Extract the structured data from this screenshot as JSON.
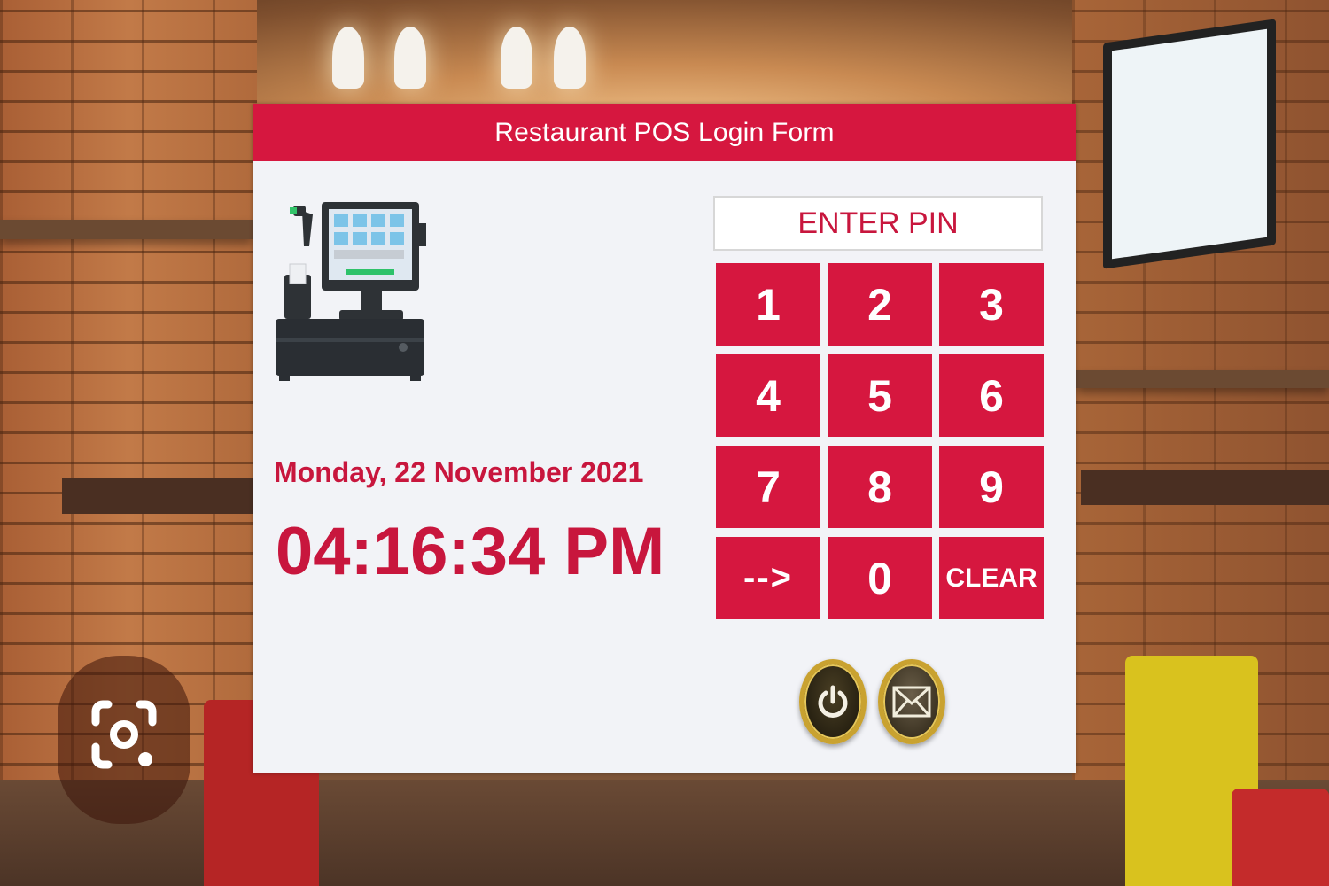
{
  "panel": {
    "title": "Restaurant POS Login Form",
    "date": "Monday, 22 November 2021",
    "time": "04:16:34 PM"
  },
  "pin": {
    "label": "ENTER PIN"
  },
  "keypad": {
    "keys": [
      "1",
      "2",
      "3",
      "4",
      "5",
      "6",
      "7",
      "8",
      "9",
      "-->",
      "0",
      "CLEAR"
    ]
  },
  "actions": {
    "power_icon": "power-icon",
    "mail_icon": "mail-icon"
  },
  "colors": {
    "accent": "#d6173f",
    "accent_text": "#c8163d",
    "panel_bg": "#f2f3f7",
    "gold_ring": "#c9a230"
  }
}
